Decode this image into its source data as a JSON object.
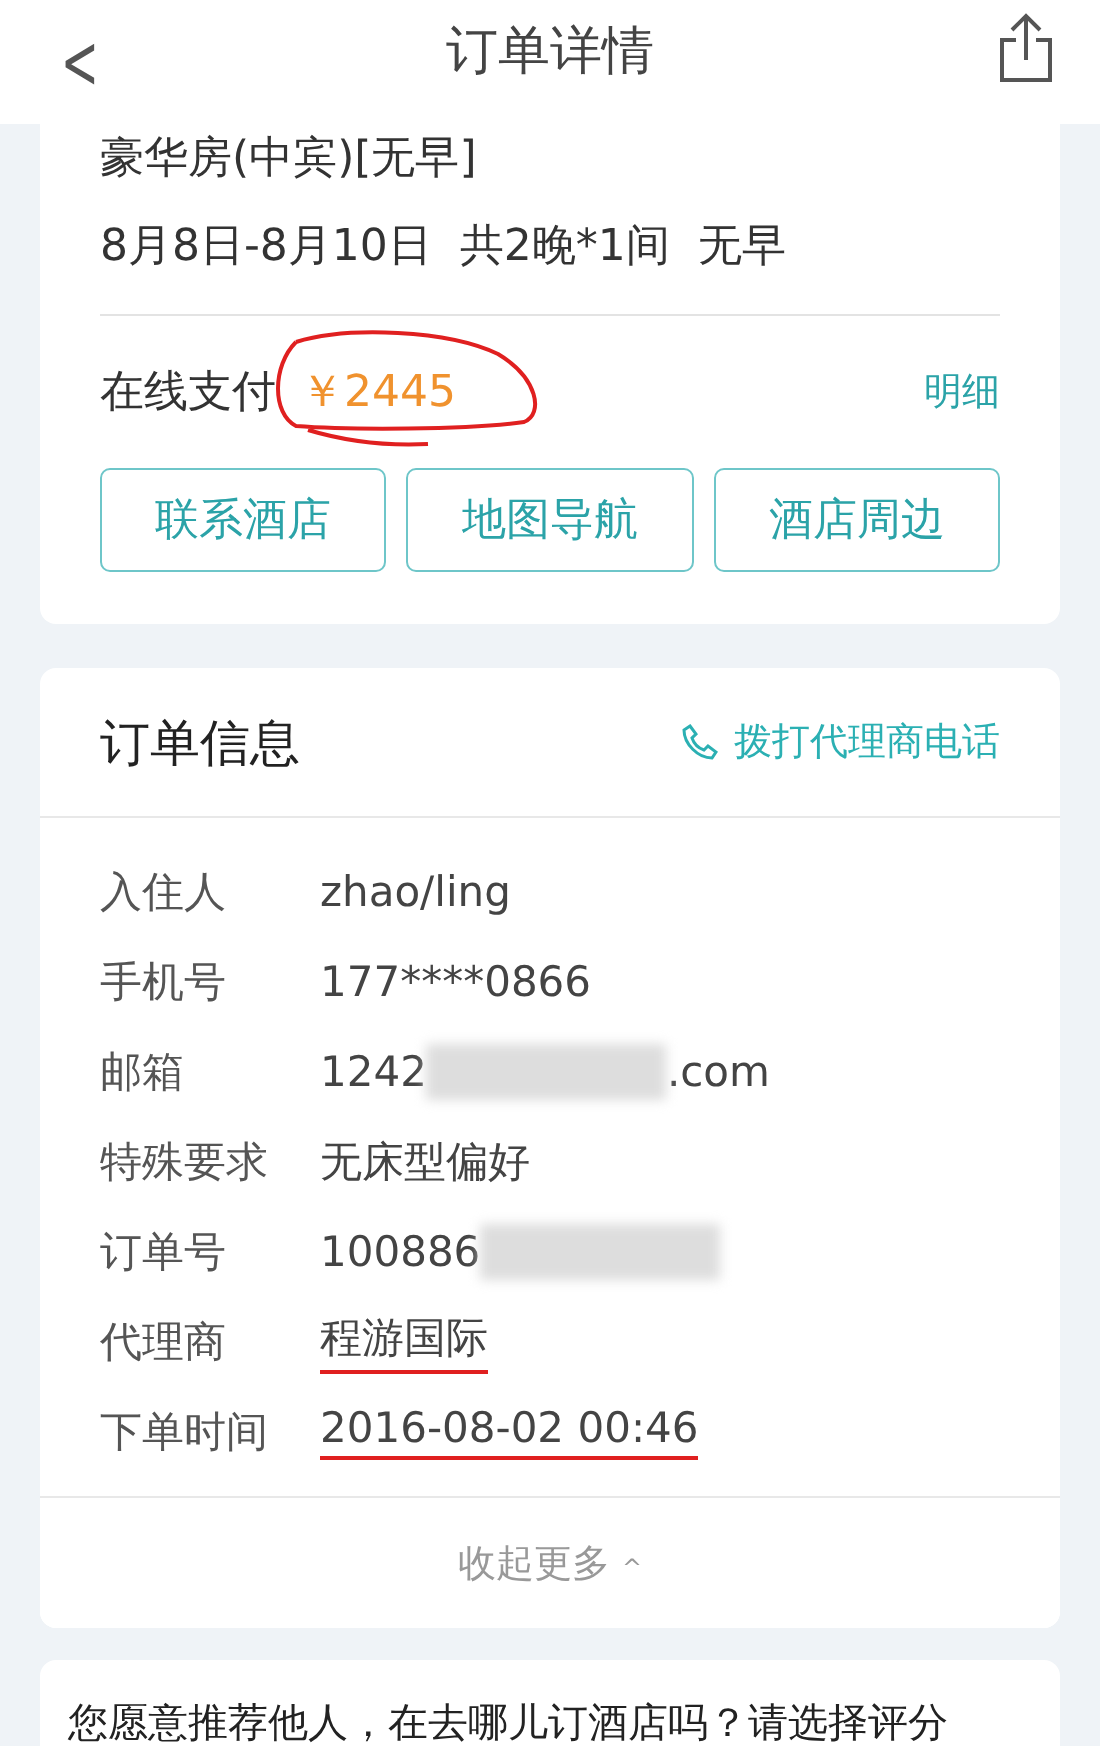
{
  "nav": {
    "back": "<",
    "title": "订单详情"
  },
  "room": {
    "name": "豪华房(中宾)[无早]",
    "stay": "8月8日-8月10日  共2晚*1间  无早"
  },
  "payment": {
    "label": "在线支付",
    "amount": "￥2445",
    "circled": true,
    "detail_link": "明细"
  },
  "actions": [
    "联系酒店",
    "地图导航",
    "酒店周边"
  ],
  "order_info": {
    "title": "订单信息",
    "call_link": "拨打代理商电话",
    "rows": [
      {
        "label": "入住人",
        "value": "zhao/ling",
        "redacted": false,
        "underlined": false
      },
      {
        "label": "手机号",
        "value": "177****0866",
        "redacted": false,
        "underlined": false
      },
      {
        "label": "邮箱",
        "value": "1242",
        "redacted": true,
        "suffix": ".com",
        "underlined": false
      },
      {
        "label": "特殊要求",
        "value": "无床型偏好",
        "redacted": false,
        "underlined": false
      },
      {
        "label": "订单号",
        "value": "100886",
        "redacted": true,
        "underlined": false
      },
      {
        "label": "代理商",
        "value": "程游国际",
        "redacted": false,
        "underlined": true
      },
      {
        "label": "下单时间",
        "value": "2016-08-02 00:46",
        "redacted": false,
        "underlined": true
      }
    ],
    "collapse": "收起更多",
    "collapse_icon": "^"
  },
  "survey": {
    "prompt": "您愿意推荐他人，在去哪儿订酒店吗？请选择评分"
  }
}
